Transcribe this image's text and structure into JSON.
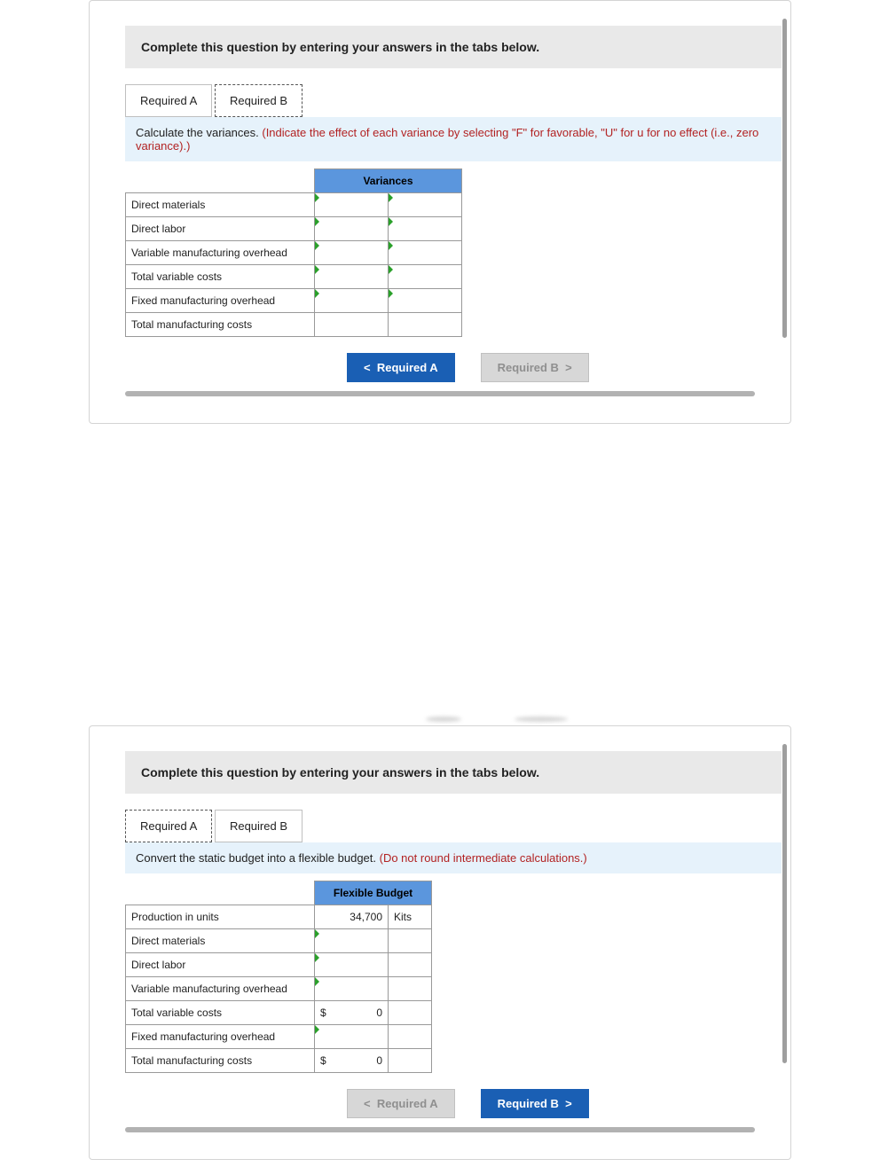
{
  "common": {
    "instruction": "Complete this question by entering your answers in the tabs below."
  },
  "tabs": {
    "a": "Required A",
    "b": "Required B"
  },
  "panel1": {
    "prompt_plain": "Calculate the variances. ",
    "prompt_red": "(Indicate the effect of each variance by selecting \"F\" for favorable, \"U\" for u for no effect (i.e., zero variance).)",
    "col_header": "Variances",
    "rows": {
      "r1": "Direct materials",
      "r2": "Direct labor",
      "r3": "Variable manufacturing overhead",
      "r4": "Total variable costs",
      "r5": "Fixed manufacturing overhead",
      "r6": "Total manufacturing costs"
    },
    "nav_prev": "Required A",
    "nav_next": "Required B"
  },
  "panel2": {
    "prompt_plain": "Convert the static budget into a flexible budget. ",
    "prompt_red": "(Do not round intermediate calculations.)",
    "col_header": "Flexible Budget",
    "rows": {
      "r1": "Production in units",
      "r2": "Direct materials",
      "r3": "Direct labor",
      "r4": "Variable manufacturing overhead",
      "r5": "Total variable costs",
      "r6": "Fixed manufacturing overhead",
      "r7": "Total manufacturing costs"
    },
    "values": {
      "production_units": "34,700",
      "production_unit_label": "Kits",
      "tvc_sym": "$",
      "tvc_val": "0",
      "tmc_sym": "$",
      "tmc_val": "0"
    },
    "nav_prev": "Required A",
    "nav_next": "Required B"
  }
}
